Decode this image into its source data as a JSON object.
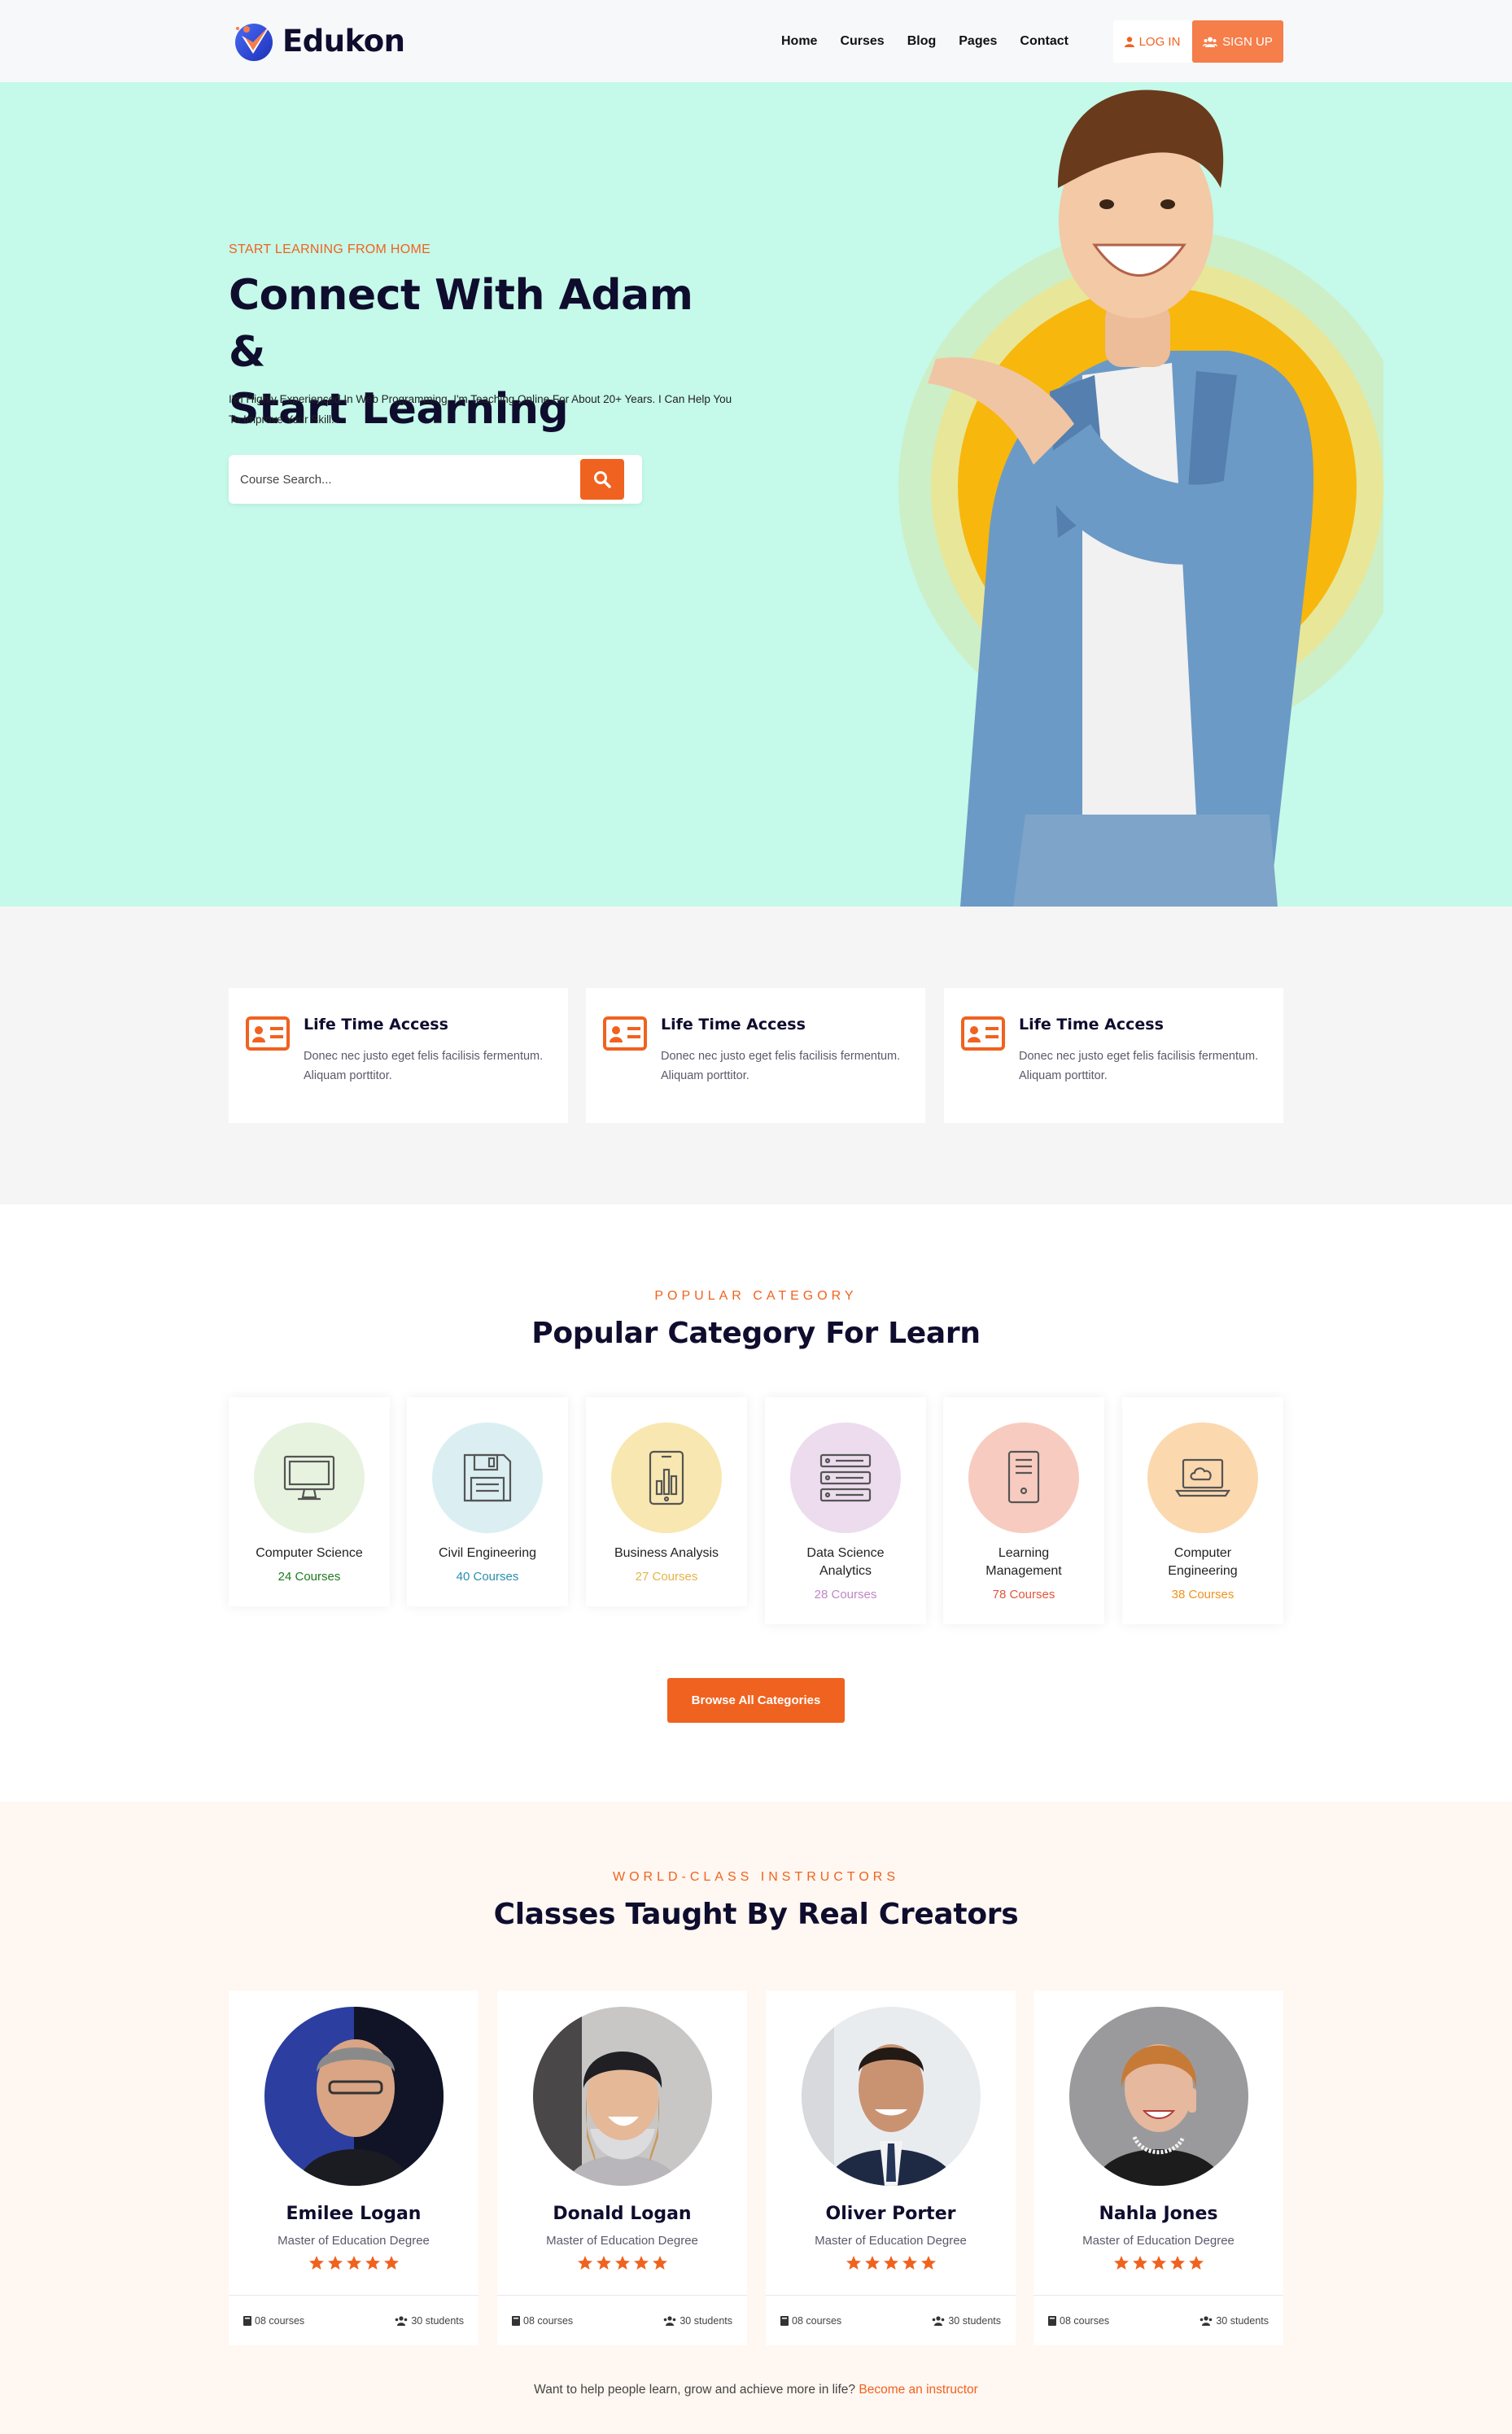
{
  "header": {
    "logo_text": "Edukon",
    "nav": [
      "Home",
      "Curses",
      "Blog",
      "Pages",
      "Contact"
    ],
    "login_label": "LOG IN",
    "signup_label": "SIGN UP"
  },
  "hero": {
    "kicker": "START LEARNING FROM HOME",
    "title_line1": "Connect With Adam &",
    "title_line2": "Start Learning",
    "description": "I'm Highly Experienced In Web Programming. I'm Teaching Online For About 20+ Years. I Can Help You To Improve Your Skill.",
    "search_placeholder": "Course Search..."
  },
  "features": [
    {
      "title": "Life Time Access",
      "desc": "Donec nec justo eget felis facilisis fermentum. Aliquam porttitor."
    },
    {
      "title": "Life Time Access",
      "desc": "Donec nec justo eget felis facilisis fermentum. Aliquam porttitor."
    },
    {
      "title": "Life Time Access",
      "desc": "Donec nec justo eget felis facilisis fermentum. Aliquam porttitor."
    }
  ],
  "categories": {
    "kicker": "POPULAR CATEGORY",
    "title": "Popular Category For Learn",
    "items": [
      {
        "name": "Computer Science",
        "count": "24 Courses",
        "color": "#1f7a1f",
        "bg": "#e7f3df",
        "icon": "monitor-icon"
      },
      {
        "name": "Civil Engineering",
        "count": "40 Courses",
        "color": "#2a8fb0",
        "bg": "#dbeff3",
        "icon": "floppy-disk-icon"
      },
      {
        "name": "Business Analysis",
        "count": "27 Courses",
        "color": "#e3b44a",
        "bg": "#f8e7b0",
        "icon": "tablet-chart-icon"
      },
      {
        "name": "Data Science Analytics",
        "count": "28 Courses",
        "color": "#c086c8",
        "bg": "#ecdcee",
        "icon": "server-rack-icon"
      },
      {
        "name": "Learning Management",
        "count": "78 Courses",
        "color": "#e0563a",
        "bg": "#f8cbc0",
        "icon": "pc-tower-icon"
      },
      {
        "name": "Computer Engineering",
        "count": "38 Courses",
        "color": "#f0921f",
        "bg": "#fcd8ae",
        "icon": "cloud-laptop-icon"
      }
    ],
    "browse_label": "Browse All Categories"
  },
  "instructors": {
    "kicker": "WORLD-CLASS INSTRUCTORS",
    "title": "Classes Taught By Real Creators",
    "items": [
      {
        "name": "Emilee Logan",
        "degree": "Master of Education Degree",
        "courses": "08 courses",
        "students": "30 students",
        "rating": 5
      },
      {
        "name": "Donald Logan",
        "degree": "Master of Education Degree",
        "courses": "08 courses",
        "students": "30 students",
        "rating": 5
      },
      {
        "name": "Oliver Porter",
        "degree": "Master of Education Degree",
        "courses": "08 courses",
        "students": "30 students",
        "rating": 5
      },
      {
        "name": "Nahla Jones",
        "degree": "Master of Education Degree",
        "courses": "08 courses",
        "students": "30 students",
        "rating": 5
      }
    ],
    "become_text": "Want to help people learn, grow and achieve more in life?",
    "become_link": "Become an instructor"
  }
}
